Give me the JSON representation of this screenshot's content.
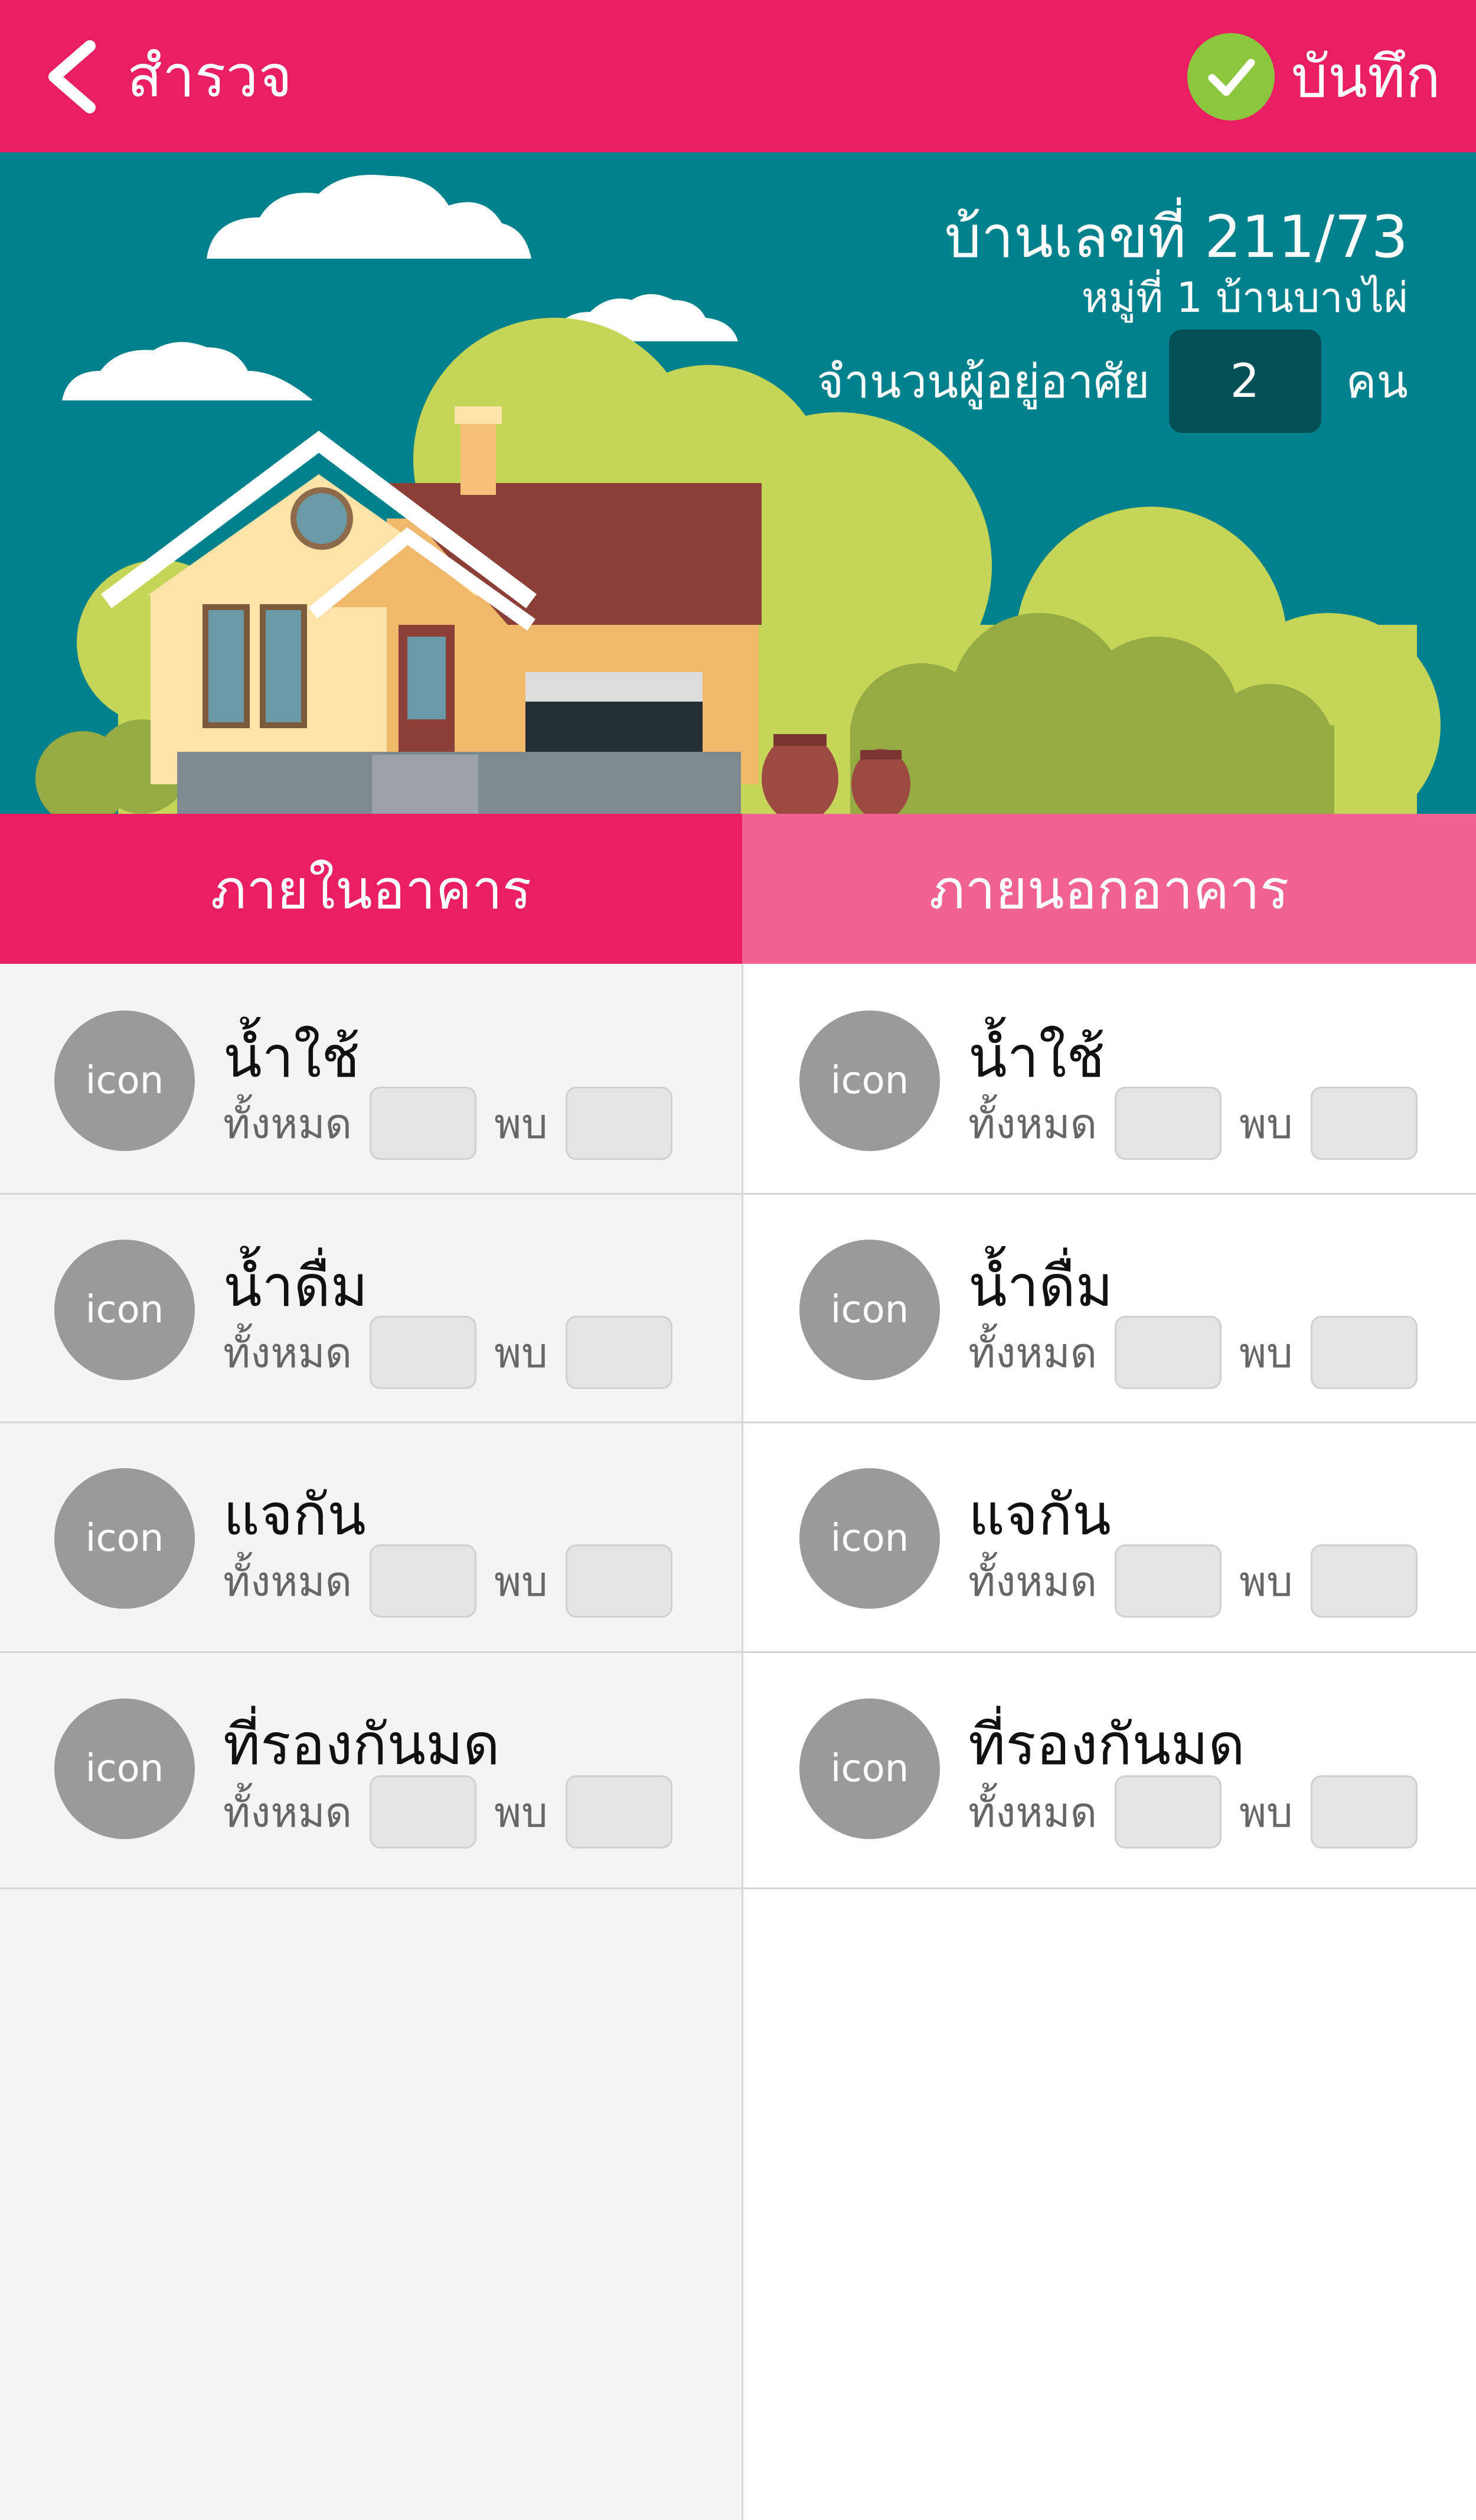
{
  "header": {
    "back_icon": "chevron-left-icon",
    "title": "สำรวจ",
    "save_icon": "check-circle-icon",
    "save_label": "บันทึก",
    "colors": {
      "bar": "#ea1e63",
      "check": "#8cc63f"
    }
  },
  "hero": {
    "house_number": "บ้านเลขที่ 211/73",
    "village": "หมู่ที่ 1 บ้านบางไผ่",
    "residents_label": "จำนวนผู้อยู่อาศัย",
    "residents_value": "2",
    "residents_unit": "คน",
    "background_color": "#00818c"
  },
  "tabs": [
    {
      "label": "ภายในอาคาร",
      "active": true
    },
    {
      "label": "ภายนอกอาคาร",
      "active": false
    }
  ],
  "indoor": {
    "items": [
      {
        "icon_text": "icon",
        "title": "น้ำใช้",
        "total_label": "ทั้งหมด",
        "found_label": "พบ"
      },
      {
        "icon_text": "icon",
        "title": "น้ำดื่ม",
        "total_label": "ทั้งหมด",
        "found_label": "พบ"
      },
      {
        "icon_text": "icon",
        "title": "แจกัน",
        "total_label": "ทั้งหมด",
        "found_label": "พบ"
      },
      {
        "icon_text": "icon",
        "title": "ที่รองกันมด",
        "total_label": "ทั้งหมด",
        "found_label": "พบ"
      }
    ]
  },
  "outdoor": {
    "items": [
      {
        "icon_text": "icon",
        "title": "น้ำใช้",
        "total_label": "ทั้งหมด",
        "found_label": "พบ"
      },
      {
        "icon_text": "icon",
        "title": "น้ำดื่ม",
        "total_label": "ทั้งหมด",
        "found_label": "พบ"
      },
      {
        "icon_text": "icon",
        "title": "แจกัน",
        "total_label": "ทั้งหมด",
        "found_label": "พบ"
      },
      {
        "icon_text": "icon",
        "title": "ที่รองกันมด",
        "total_label": "ทั้งหมด",
        "found_label": "พบ"
      }
    ]
  }
}
